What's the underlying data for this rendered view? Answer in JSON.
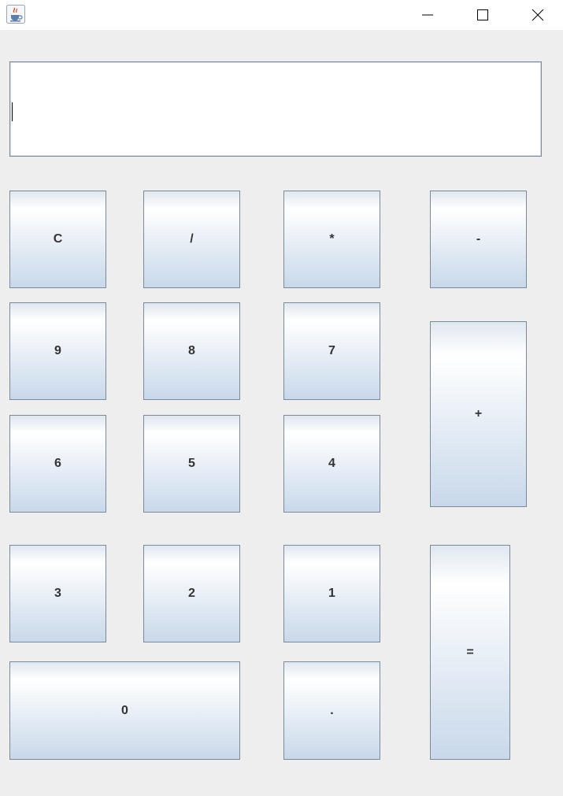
{
  "window": {
    "app_icon": "java-coffee-cup-icon",
    "controls": [
      "minimize-icon",
      "maximize-icon",
      "close-icon"
    ]
  },
  "display": {
    "value": "",
    "placeholder": ""
  },
  "keys": {
    "clear": "C",
    "divide": "/",
    "multiply": "*",
    "subtract": "-",
    "nine": "9",
    "eight": "8",
    "seven": "7",
    "add": "+",
    "six": "6",
    "five": "5",
    "four": "4",
    "three": "3",
    "two": "2",
    "one": "1",
    "equals": "=",
    "zero": "0",
    "decimal": "."
  },
  "colors": {
    "window_bg": "#eeeeee",
    "titlebar_bg": "#ffffff",
    "key_gradient_top": "#ffffff",
    "key_gradient_bottom": "#c8d8ea",
    "key_border": "#7a8a99",
    "key_text": "#333333"
  }
}
